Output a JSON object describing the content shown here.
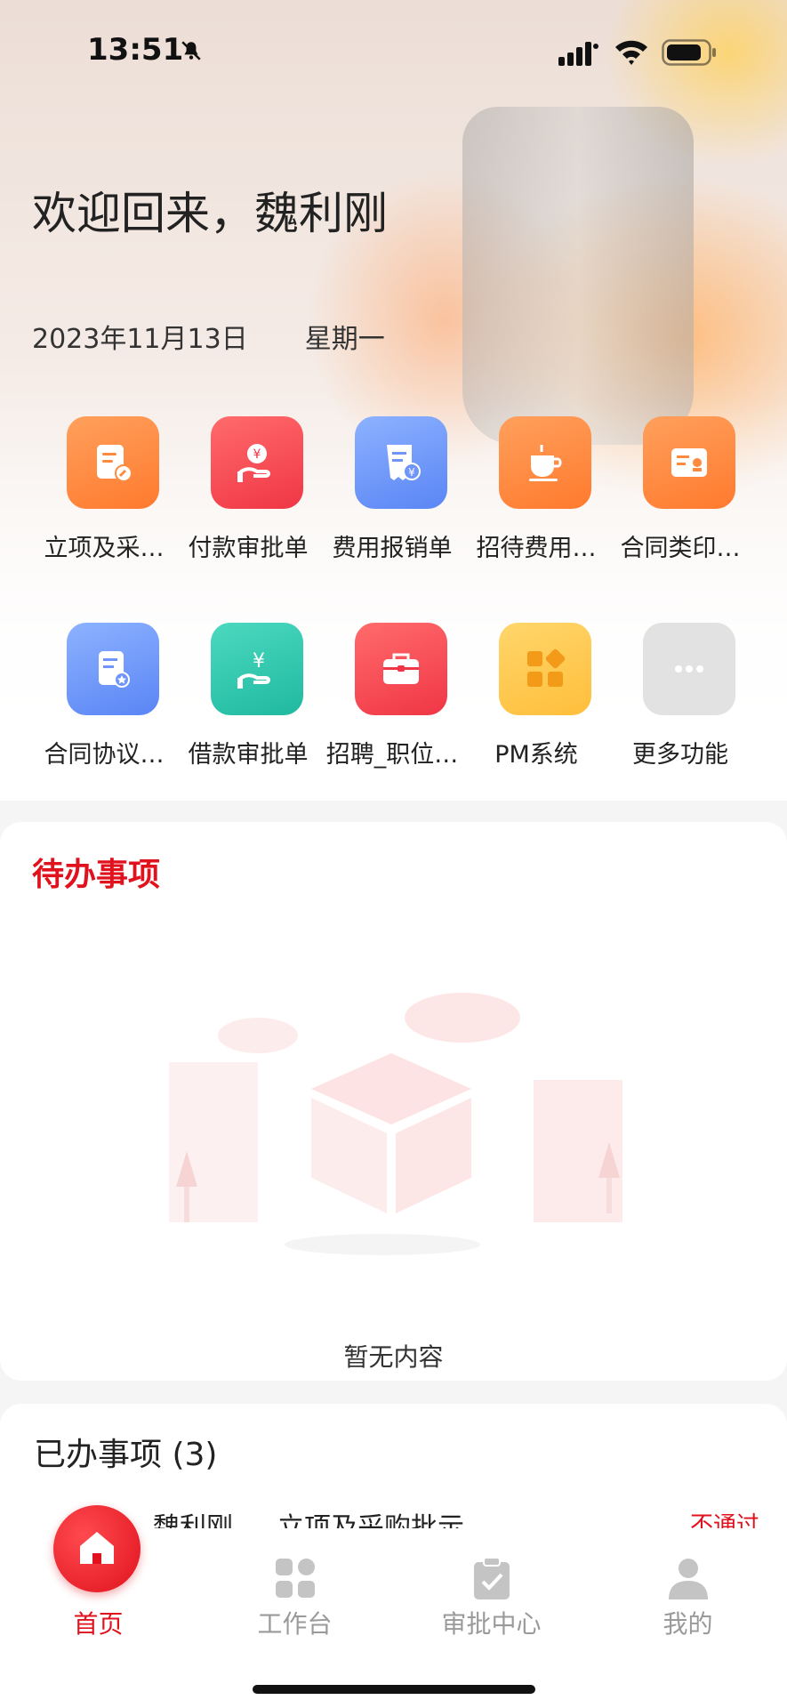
{
  "status_bar": {
    "time": "13:51"
  },
  "header": {
    "greeting": "欢迎回来，魏利刚",
    "date": "2023年11月13日",
    "weekday": "星期一"
  },
  "shortcuts": [
    {
      "label": "立项及采…",
      "icon": "document-edit-icon",
      "color": "orange"
    },
    {
      "label": "付款审批单",
      "icon": "yen-hand-icon",
      "color": "red"
    },
    {
      "label": "费用报销单",
      "icon": "receipt-yen-icon",
      "color": "blue"
    },
    {
      "label": "招待费用…",
      "icon": "coffee-cup-icon",
      "color": "orange"
    },
    {
      "label": "合同类印…",
      "icon": "certificate-icon",
      "color": "orange"
    },
    {
      "label": "合同协议…",
      "icon": "contract-doc-icon",
      "color": "blue"
    },
    {
      "label": "借款审批单",
      "icon": "loan-yen-icon",
      "color": "teal"
    },
    {
      "label": "招聘_职位…",
      "icon": "briefcase-icon",
      "color": "red"
    },
    {
      "label": "PM系统",
      "icon": "app-grid-icon",
      "color": "yellow"
    },
    {
      "label": "更多功能",
      "icon": "more-dots-icon",
      "color": "gray"
    }
  ],
  "todo": {
    "title": "待办事项",
    "empty_text": "暂无内容"
  },
  "done": {
    "title": "已办事项 (3)",
    "rows": [
      {
        "person": "魏利刚",
        "item": "立项及采购批示",
        "status": "不通过"
      }
    ]
  },
  "tabbar": {
    "tabs": [
      {
        "label": "首页",
        "icon": "home-icon",
        "active": true
      },
      {
        "label": "工作台",
        "icon": "workbench-icon",
        "active": false
      },
      {
        "label": "审批中心",
        "icon": "approval-clipboard-icon",
        "active": false
      },
      {
        "label": "我的",
        "icon": "profile-icon",
        "active": false
      }
    ]
  },
  "colors": {
    "accent": "#e0121d",
    "tab_inactive": "#9a9a9a"
  }
}
